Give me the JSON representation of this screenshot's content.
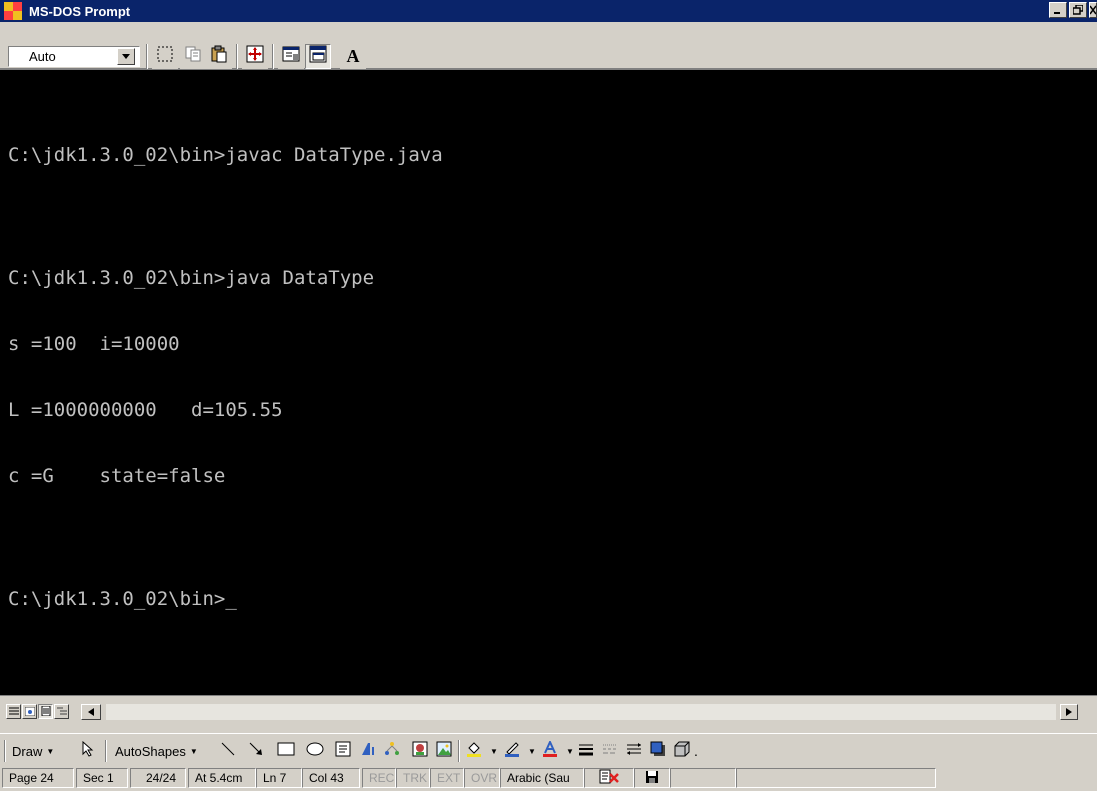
{
  "window": {
    "title": "MS-DOS Prompt",
    "icon_label": "MS"
  },
  "toolbar": {
    "font_size_value": "Auto",
    "buttons": [
      "mark-icon",
      "copy-icon",
      "paste-icon",
      "full-screen-icon",
      "properties-icon",
      "background-icon",
      "font-icon"
    ],
    "font_button_label": "A"
  },
  "console": {
    "lines": [
      "C:\\jdk1.3.0_02\\bin>javac DataType.java",
      "",
      "C:\\jdk1.3.0_02\\bin>java DataType",
      "s =100  i=10000",
      "L =1000000000   d=105.55",
      "c =G    state=false",
      "",
      "C:\\jdk1.3.0_02\\bin>_"
    ]
  },
  "drawbar": {
    "draw_label": "Draw",
    "autoshapes_label": "AutoShapes"
  },
  "statusbar": {
    "page": "Page 24",
    "sec": "Sec 1",
    "page_of": "24/24",
    "at": "At 5.4cm",
    "ln": "Ln 7",
    "col": "Col 43",
    "rec": "REC",
    "trk": "TRK",
    "ext": "EXT",
    "ovr": "OVR",
    "language": "Arabic (Sau"
  },
  "colors": {
    "titlebar": "#0a246a",
    "console_bg": "#000000",
    "console_fg": "#c0c0c0",
    "chrome": "#d4d0c8"
  }
}
